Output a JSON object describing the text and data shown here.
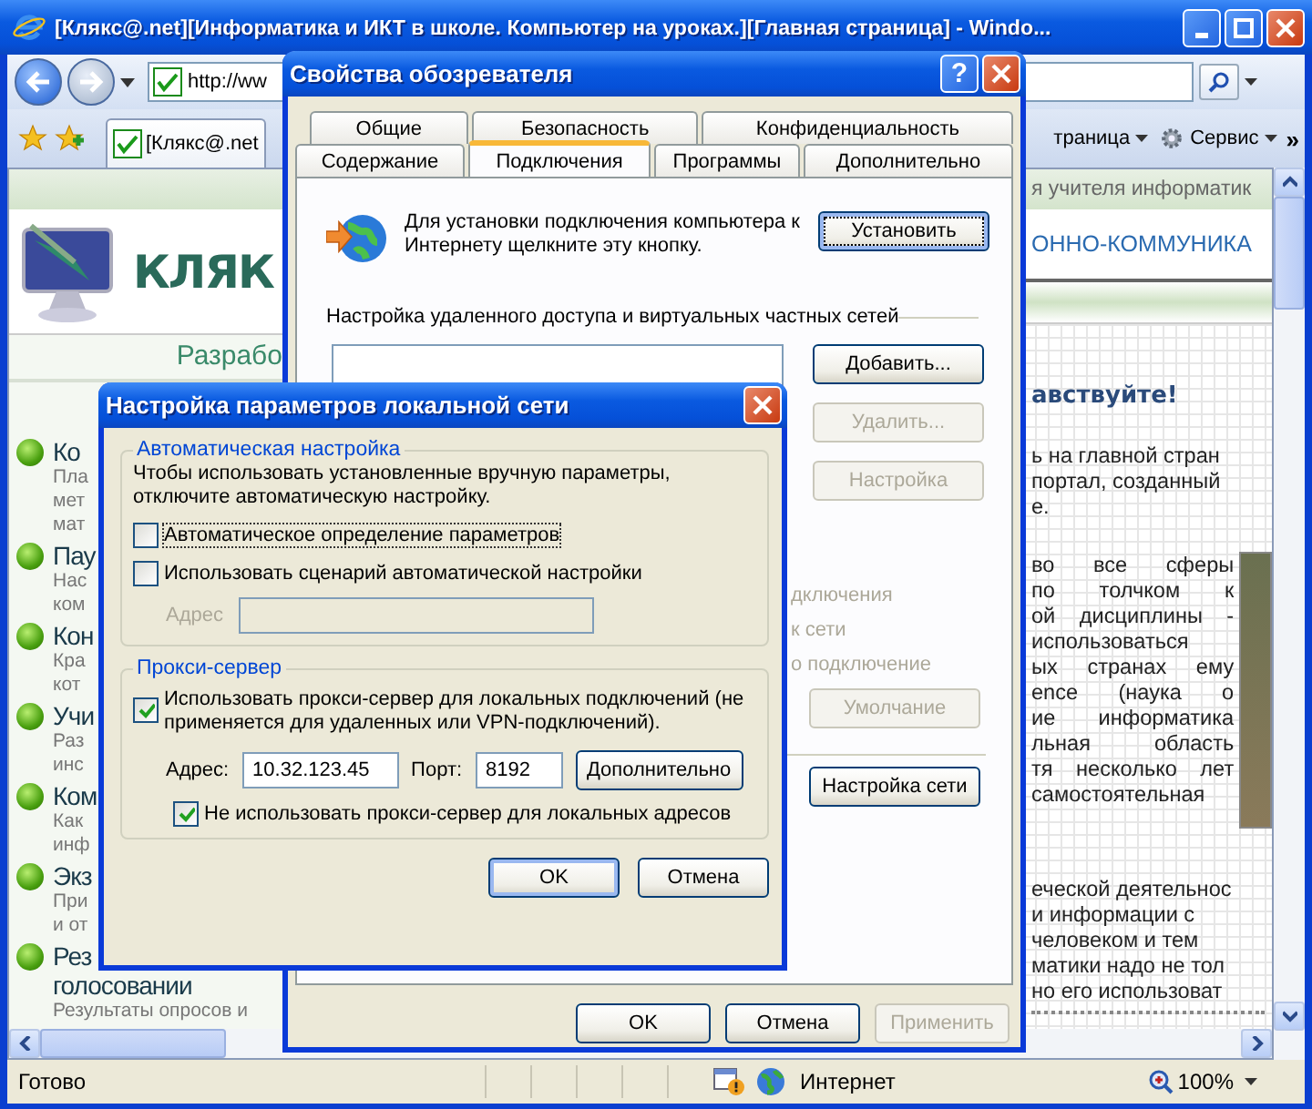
{
  "browser": {
    "title": "[Клякс@.net][Информатика и ИКТ в школе. Компьютер на уроках.][Главная страница] - Windo...",
    "address": "http://ww",
    "tab": "[Клякс@.net",
    "commands": [
      {
        "label": "траница",
        "kind": "plain"
      },
      {
        "label": "Сервис",
        "kind": "gear"
      }
    ],
    "overflow": "»",
    "status": "Готово",
    "zone": "Интернет",
    "zoom": "100%"
  },
  "page": {
    "top_strip": "я учителя информатик",
    "logo": "КЛЯК",
    "banner": "ОННО-КОММУНИКА",
    "subtitle": "Разрабо",
    "menu": [
      {
        "title": [
          "Ко"
        ],
        "lines": [
          "Пла",
          "мет",
          "мат"
        ]
      },
      {
        "title": [
          "Пау"
        ],
        "lines": [
          "Нас",
          "ком"
        ]
      },
      {
        "title": [
          "Кон"
        ],
        "lines": [
          "Кра",
          "кот"
        ]
      },
      {
        "title": [
          "Учи"
        ],
        "lines": [
          "Раз",
          "инс"
        ]
      },
      {
        "title": [
          "Ком"
        ],
        "lines": [
          "Как",
          "инф"
        ]
      },
      {
        "title": [
          "Экз"
        ],
        "lines": [
          "При",
          "и от"
        ]
      },
      {
        "title": [
          "Рез",
          "голосовании"
        ],
        "lines": [
          "Результаты опросов и"
        ]
      }
    ],
    "greeting": "авствуйте!",
    "paragraphs": [
      {
        "kind": "plain",
        "lines": [
          "ь на главной стран",
          "портал, созданный",
          "е."
        ]
      },
      {
        "kind": "photo",
        "lines": [
          "во все сферы",
          "по толчком к",
          "ой дисциплины -",
          "использоваться",
          "ых странах ему",
          "ence (наука о",
          "ие информатика",
          "льная область",
          "тя несколько лет",
          "самостоятельная"
        ]
      },
      {
        "kind": "plain",
        "lines": [
          "еческой деятельнос",
          "и информации с",
          "человеком и тем",
          "матики надо не тол",
          "но его использоват"
        ]
      }
    ]
  },
  "internet_options": {
    "title": "Свойства обозревателя",
    "help": "?",
    "tab_rows": [
      [
        {
          "label": "Общие",
          "selected": false
        },
        {
          "label": "Безопасность",
          "selected": false
        },
        {
          "label": "Конфиденциальность",
          "selected": false
        }
      ],
      [
        {
          "label": "Содержание",
          "selected": false
        },
        {
          "label": "Подключения",
          "selected": true
        },
        {
          "label": "Программы",
          "selected": false
        },
        {
          "label": "Дополнительно",
          "selected": false
        }
      ]
    ],
    "setup_text": "Для установки подключения компьютера к Интернету щелкните эту кнопку.",
    "setup_button": {
      "label": "Установить",
      "disabled": false
    },
    "dialup_group": "Настройка удаленного доступа и виртуальных частных сетей",
    "dialup_buttons": [
      {
        "label": "Добавить...",
        "disabled": false
      },
      {
        "label": "Удалить...",
        "disabled": true
      },
      {
        "label": "Настройка",
        "disabled": true
      }
    ],
    "radio_fragments": [
      {
        "label": "дключения",
        "disabled": true
      },
      {
        "label": "к сети",
        "disabled": true
      },
      {
        "label": "о подключение",
        "disabled": true
      }
    ],
    "default_button": {
      "label": "Умолчание",
      "disabled": true
    },
    "lan_button": {
      "label": "Настройка сети",
      "disabled": false
    },
    "buttons": [
      {
        "label": "OK",
        "disabled": false
      },
      {
        "label": "Отмена",
        "disabled": false
      },
      {
        "label": "Применить",
        "disabled": true
      }
    ]
  },
  "lan_dialog": {
    "title": "Настройка параметров локальной сети",
    "auto_group": "Автоматическая настройка",
    "auto_text": "Чтобы использовать установленные вручную параметры, отключите автоматическую настройку.",
    "auto_checks": [
      {
        "label": "Автоматическое определение параметров",
        "checked": false
      },
      {
        "label": "Использовать сценарий автоматической настройки",
        "checked": false
      }
    ],
    "script_address": {
      "label": "Адрес",
      "disabled": true
    },
    "proxy_group": "Прокси-сервер",
    "proxy_check": {
      "label": "Использовать прокси-сервер для локальных подключений (не применяется для удаленных или VPN-подключений).",
      "checked": true
    },
    "address_label": "Адрес:",
    "address": "10.32.123.45",
    "port_label": "Порт:",
    "port": "8192",
    "advanced_button": "Дополнительно",
    "bypass_check": {
      "label": "Не использовать прокси-сервер для локальных адресов",
      "checked": true
    },
    "buttons": [
      {
        "label": "OK",
        "disabled": false
      },
      {
        "label": "Отмена",
        "disabled": false
      }
    ]
  }
}
